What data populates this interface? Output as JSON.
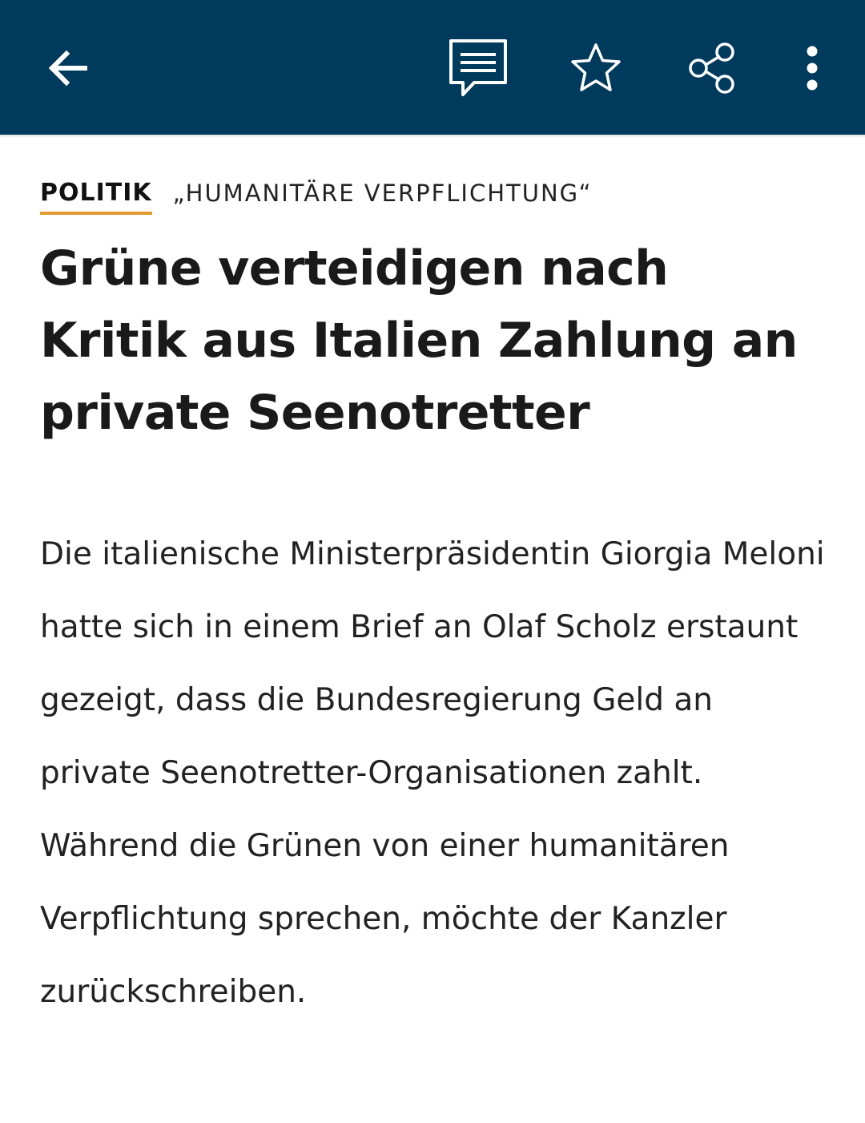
{
  "toolbar": {
    "back_icon": "arrow-left-icon",
    "comments_icon": "comment-icon",
    "bookmark_icon": "star-icon",
    "share_icon": "share-icon",
    "more_icon": "more-vertical-icon",
    "background_color": "#003a5d"
  },
  "article": {
    "category": "POLITIK",
    "topline": "„HUMANITÄRE VERPFLICHTUNG“",
    "headline": "Grüne verteidigen nach Kritik aus Italien Zahlung an private Seenotretter",
    "teaser": "Die italienische Ministerpräsidentin Giorgia Meloni hatte sich in einem Brief an Olaf Scholz erstaunt gezeigt, dass die Bundesregierung Geld an private Seenotretter-Organisationen zahlt. Während die Grünen von einer humanitären Verpflichtung sprechen, möchte der Kanzler zurückschreiben.",
    "accent_color": "#e19b2e"
  }
}
